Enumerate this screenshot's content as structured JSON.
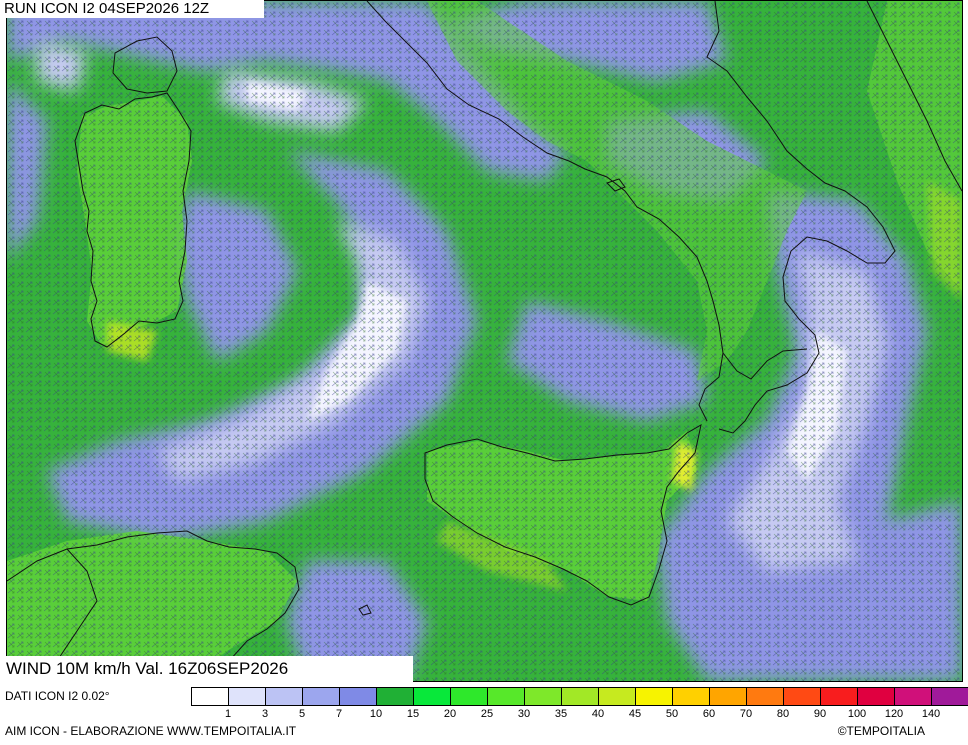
{
  "header": {
    "run_title": "RUN ICON I2 04SEP2026 12Z"
  },
  "map": {
    "variable_title": "WIND 10M km/h Val. 16Z06SEP2026",
    "colors": {
      "sea_green": "#36b23c",
      "calm_lavender": "#8f95e6",
      "calm_light": "#c6caf2",
      "calm_white": "#f4f5ff",
      "land_green": "#5fd23a",
      "strong_yellow": "#c8e81e",
      "coast_line": "#111111"
    }
  },
  "footer": {
    "data_source": "DATI ICON I2 0.02°",
    "credit_left": "AIM ICON - ELABORAZIONE WWW.TEMPOITALIA.IT",
    "credit_right": "©TEMPOITALIA"
  },
  "legend": {
    "colors": [
      "#ffffff",
      "#dfe3fb",
      "#bcc3f4",
      "#9ca6ee",
      "#7f8ae6",
      "#20b035",
      "#08e83a",
      "#2ee82b",
      "#57e82a",
      "#7ee82a",
      "#a2e826",
      "#c6ea1f",
      "#f7f300",
      "#ffd000",
      "#ffa500",
      "#ff7a10",
      "#ff4a14",
      "#f81d1e",
      "#e00040",
      "#d0107a",
      "#a01a9a",
      "#6a1a7a"
    ],
    "labels": [
      "1",
      "3",
      "5",
      "7",
      "10",
      "15",
      "20",
      "25",
      "30",
      "35",
      "40",
      "45",
      "50",
      "60",
      "70",
      "80",
      "90",
      "100",
      "120",
      "140"
    ]
  }
}
